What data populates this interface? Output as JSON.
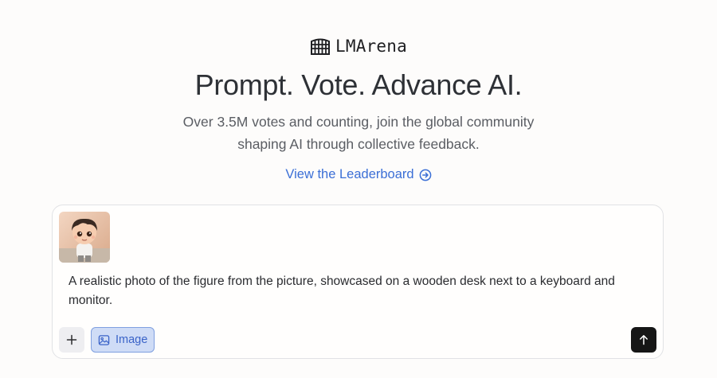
{
  "brand": {
    "name": "LMArena",
    "logo_icon": "colosseum-icon"
  },
  "hero": {
    "title": "Prompt. Vote. Advance AI.",
    "subtitle_line1": "Over 3.5M votes and counting, join the global community",
    "subtitle_line2": "shaping AI through collective feedback."
  },
  "leaderboard_link": {
    "label": "View the Leaderboard",
    "icon": "arrow-right-circle-icon"
  },
  "composer": {
    "attachment": {
      "type": "image",
      "description_icon": "cartoon-boy-thumbnail"
    },
    "prompt_text": "A realistic photo of the figure from the picture, showcased on a wooden desk next to a keyboard and monitor.",
    "add_button_icon": "plus-icon",
    "image_mode_label": "Image",
    "image_mode_icon": "image-icon",
    "send_icon": "arrow-up-icon"
  },
  "colors": {
    "link": "#3b6fd6",
    "image_chip_bg": "#cfdcf6",
    "image_chip_border": "#7f9fe0",
    "send_button": "#161616"
  }
}
